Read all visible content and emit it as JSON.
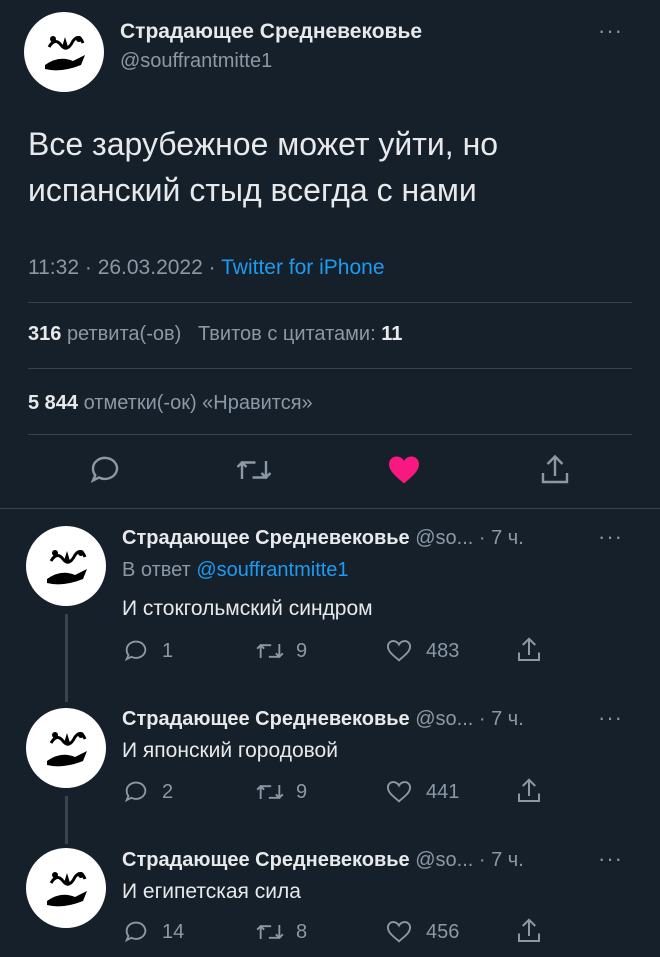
{
  "main": {
    "author": {
      "name": "Страдающее Средневековье",
      "handle": "@souffrantmitte1"
    },
    "text_line1": "Все зарубежное может уйти, но",
    "text_line2": "испанский стыд всегда с нами",
    "time": "11:32",
    "sep1": "·",
    "date": "26.03.2022",
    "sep2": "·",
    "source": "Twitter for iPhone",
    "retweets_count": "316",
    "retweets_label": "ретвита(-ов)",
    "quotes_label": "Твитов с цитатами:",
    "quotes_count": "11",
    "likes_count": "5 844",
    "likes_label": "отметки(-ок) «Нравится»"
  },
  "replies": [
    {
      "name": "Страдающее Средневековье",
      "handle": "@so...",
      "time": "· 7 ч.",
      "reply_prefix": "В ответ",
      "reply_to": "@souffrantmitte1",
      "text": "И стокгольмский синдром",
      "replies": "1",
      "retweets": "9",
      "likes": "483"
    },
    {
      "name": "Страдающее Средневековье",
      "handle": "@so...",
      "time": "· 7 ч.",
      "text": "И японский городовой",
      "replies": "2",
      "retweets": "9",
      "likes": "441"
    },
    {
      "name": "Страдающее Средневековье",
      "handle": "@so...",
      "time": "· 7 ч.",
      "text": "И египетская сила",
      "replies": "14",
      "retweets": "8",
      "likes": "456"
    }
  ],
  "more_glyph": "···",
  "colors": {
    "background": "#15202b",
    "text": "#e7e9ea",
    "muted": "#8b98a5",
    "link": "#1d9bf0",
    "like_active": "#f91880",
    "divider": "#38444d"
  }
}
